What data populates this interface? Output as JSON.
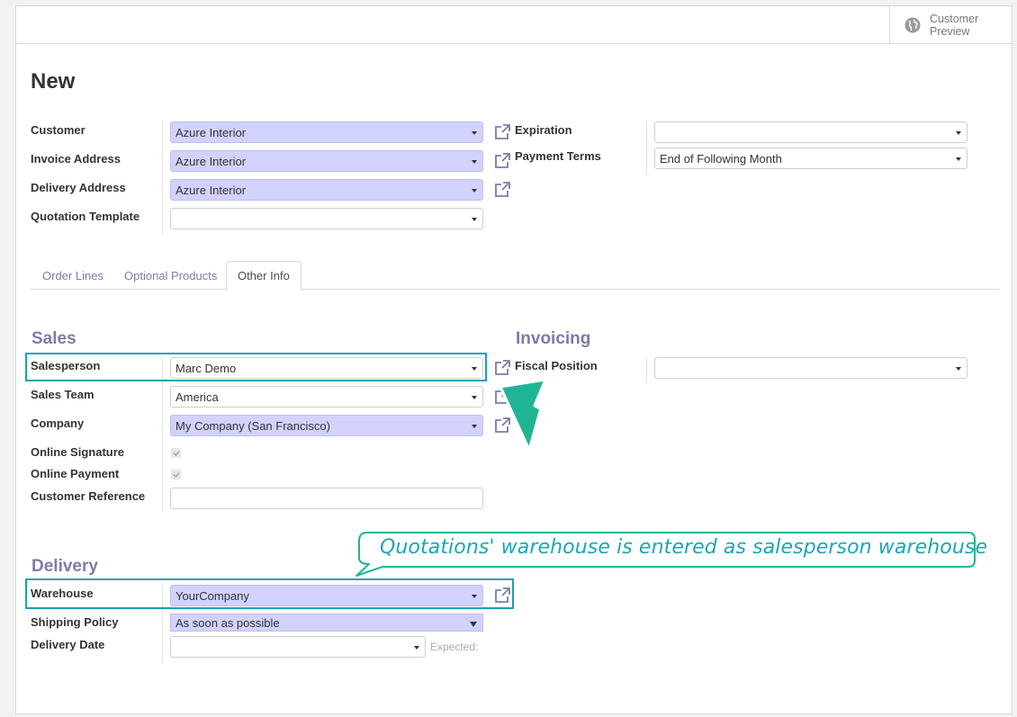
{
  "header": {
    "preview_label": "Customer Preview",
    "preview_icon": "globe-icon"
  },
  "page": {
    "title": "New"
  },
  "form_left": [
    {
      "label": "Customer",
      "value": "Azure Interior"
    },
    {
      "label": "Invoice Address",
      "value": "Azure Interior"
    },
    {
      "label": "Delivery Address",
      "value": "Azure Interior"
    },
    {
      "label": "Quotation Template",
      "value": ""
    }
  ],
  "form_right": [
    {
      "label": "Expiration",
      "value": ""
    },
    {
      "label": "Payment Terms",
      "value": "End of Following Month"
    }
  ],
  "tabs": [
    {
      "label": "Order Lines",
      "active": false
    },
    {
      "label": "Optional Products",
      "active": false
    },
    {
      "label": "Other Info",
      "active": true
    }
  ],
  "sales": {
    "heading": "Sales",
    "salesperson": {
      "label": "Salesperson",
      "value": "Marc Demo"
    },
    "sales_team": {
      "label": "Sales Team",
      "value": "America"
    },
    "company": {
      "label": "Company",
      "value": "My Company (San Francisco)"
    },
    "online_signature": {
      "label": "Online Signature",
      "checked": true
    },
    "online_payment": {
      "label": "Online Payment",
      "checked": true
    },
    "customer_reference": {
      "label": "Customer Reference",
      "value": ""
    }
  },
  "invoicing": {
    "heading": "Invoicing",
    "fiscal_position": {
      "label": "Fiscal Position",
      "value": ""
    }
  },
  "delivery": {
    "heading": "Delivery",
    "warehouse": {
      "label": "Warehouse",
      "value": "YourCompany"
    },
    "shipping_policy": {
      "label": "Shipping Policy",
      "value": "As soon as possible"
    },
    "delivery_date": {
      "label": "Delivery Date",
      "value": "",
      "expected_label": "Expected:"
    }
  },
  "annotation": {
    "text": "Quotations' warehouse is entered as salesperson warehouse",
    "highlight_color": "#17a3b3",
    "arrow_color": "#1fb594"
  },
  "colors": {
    "accent": "#7c7bad",
    "required_field": "#d2d2ff"
  }
}
